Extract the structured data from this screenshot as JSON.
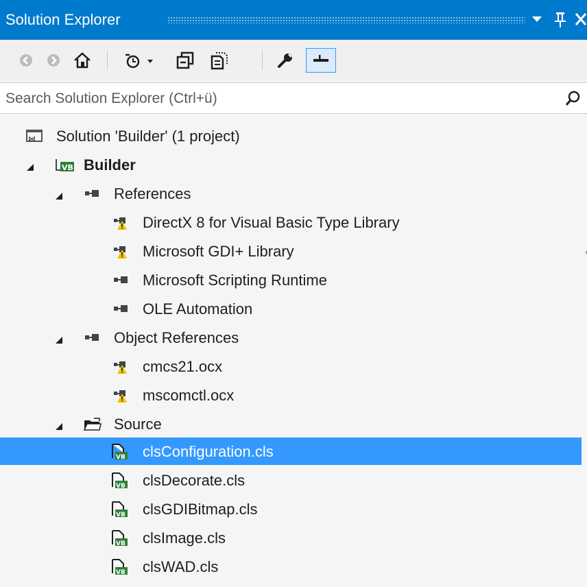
{
  "window": {
    "title": "Solution Explorer",
    "controls": {
      "dropdown_icon": "dropdown-arrow-icon",
      "pin_icon": "pin-icon",
      "close_icon": "close-icon"
    }
  },
  "toolbar": {
    "buttons": [
      {
        "name": "back-button",
        "icon": "back-arrow-icon"
      },
      {
        "name": "forward-button",
        "icon": "forward-arrow-icon"
      },
      {
        "name": "home-button",
        "icon": "home-icon"
      },
      {
        "name": "pending-changes-filter-button",
        "icon": "clock-icon"
      },
      {
        "name": "collapse-all-button",
        "icon": "collapse-all-icon"
      },
      {
        "name": "show-all-files-button",
        "icon": "show-all-files-icon"
      },
      {
        "name": "properties-button",
        "icon": "wrench-icon"
      },
      {
        "name": "preview-selected-button",
        "icon": "preview-icon"
      }
    ]
  },
  "search": {
    "placeholder": "Search Solution Explorer (Ctrl+ü)",
    "value": ""
  },
  "tree": {
    "solution": {
      "label": "Solution 'Builder' (1 project)",
      "icon": "solution-icon"
    },
    "project": {
      "label": "Builder",
      "icon": "vb-project-icon",
      "expanded": true
    },
    "references": {
      "label": "References",
      "icon": "references-icon",
      "items": [
        {
          "label": "DirectX 8 for Visual Basic Type Library",
          "icon": "reference-warning-icon"
        },
        {
          "label": "Microsoft GDI+ Library",
          "icon": "reference-warning-icon"
        },
        {
          "label": "Microsoft Scripting Runtime",
          "icon": "reference-icon"
        },
        {
          "label": "OLE Automation",
          "icon": "reference-icon"
        }
      ]
    },
    "object_references": {
      "label": "Object References",
      "icon": "references-icon",
      "items": [
        {
          "label": "cmcs21.ocx",
          "icon": "reference-warning-icon"
        },
        {
          "label": "mscomctl.ocx",
          "icon": "reference-warning-icon"
        }
      ]
    },
    "source": {
      "label": "Source",
      "icon": "folder-icon",
      "items": [
        {
          "label": "clsConfiguration.cls",
          "icon": "vb-class-icon",
          "selected": true
        },
        {
          "label": "clsDecorate.cls",
          "icon": "vb-class-icon"
        },
        {
          "label": "clsGDIBitmap.cls",
          "icon": "vb-class-icon"
        },
        {
          "label": "clsImage.cls",
          "icon": "vb-class-icon"
        },
        {
          "label": "clsWAD.cls",
          "icon": "vb-class-icon"
        }
      ]
    }
  }
}
